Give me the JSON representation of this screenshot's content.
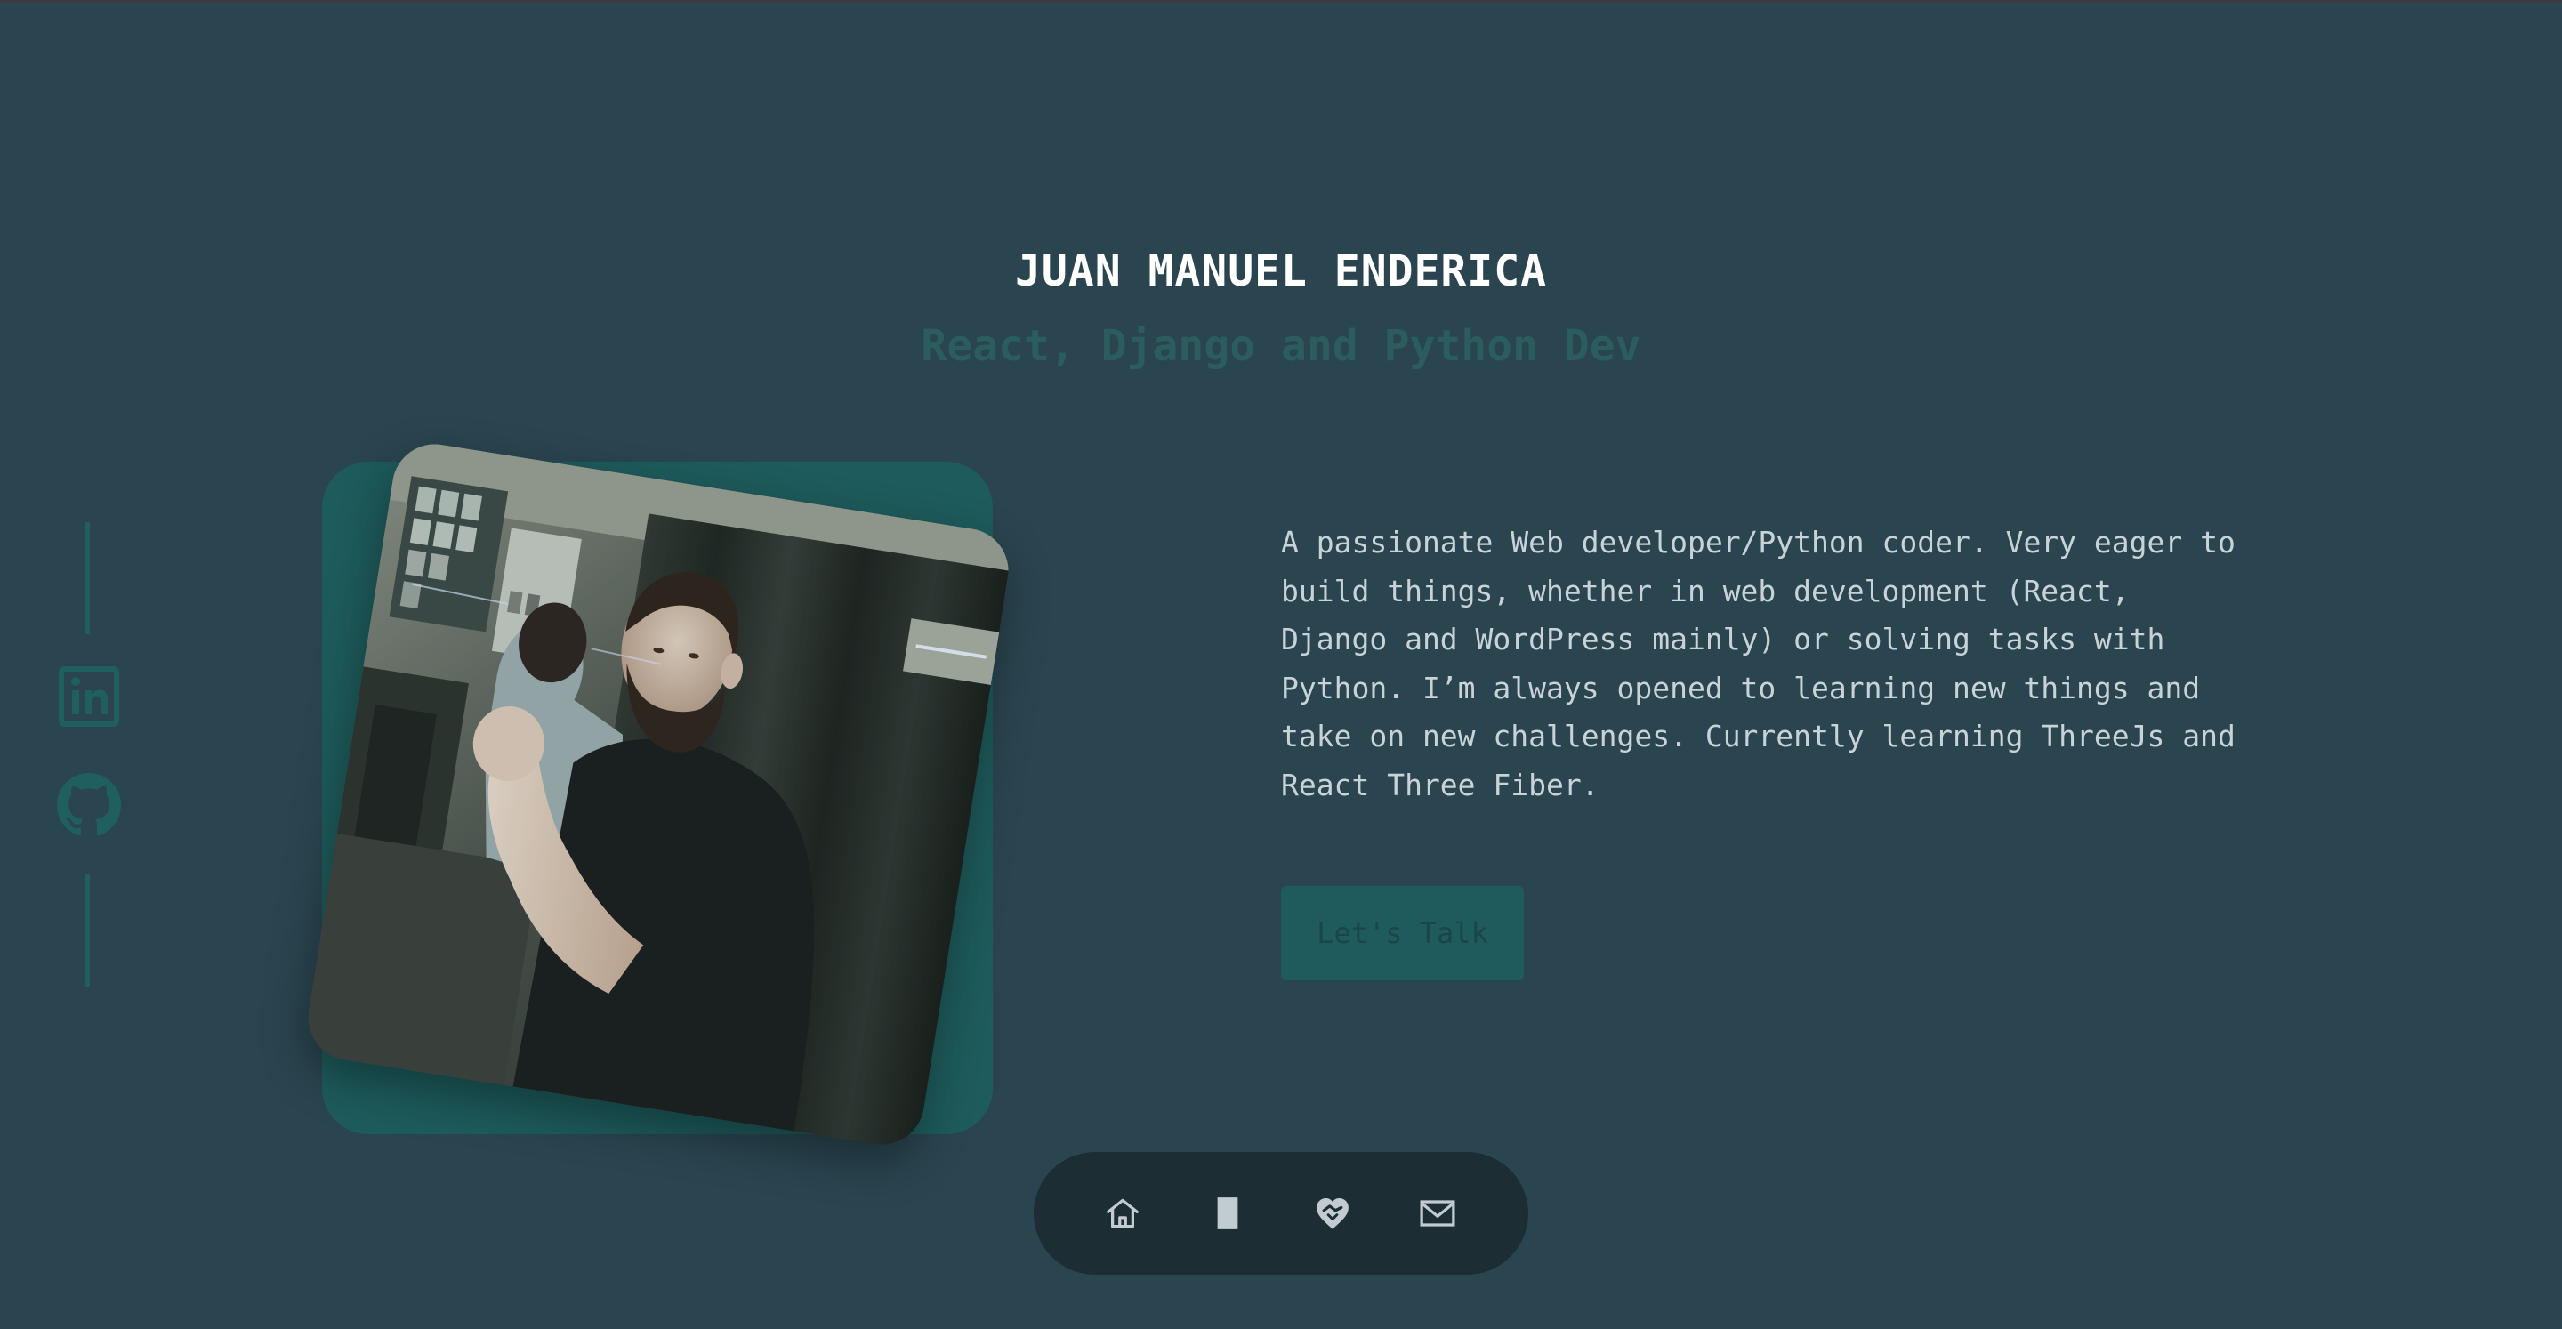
{
  "profile": {
    "name": "JUAN MANUEL ENDERICA",
    "tagline": "React, Django and Python Dev",
    "about": "A passionate Web developer/Python coder. Very eager to build things, whether in web development (React, Django and WordPress mainly) or solving tasks with Python. I’m always opened to learning new things and take on new challenges. Currently learning ThreeJs and React Three Fiber.",
    "cta_label": "Let's Talk"
  },
  "social": [
    {
      "icon": "linkedin-icon"
    },
    {
      "icon": "github-icon"
    }
  ],
  "nav": [
    {
      "icon": "home-icon"
    },
    {
      "icon": "document-icon"
    },
    {
      "icon": "heart-handshake-icon"
    },
    {
      "icon": "mail-icon"
    }
  ],
  "colors": {
    "background": "#2a4550",
    "accent": "#1f5b5c",
    "tagline": "#2b5c5e",
    "nav_background": "#1c2d33",
    "text": "#c9d3d7"
  }
}
